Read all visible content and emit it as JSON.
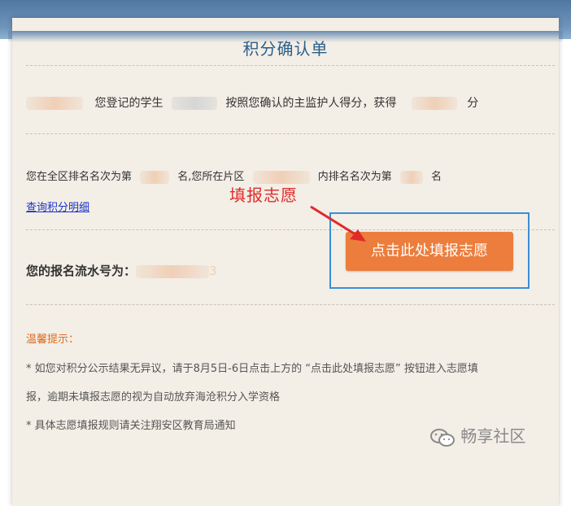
{
  "form": {
    "title": "积分确认单",
    "line1_a": "您登记的学生",
    "line1_b": "按照您确认的主监护人得分，获得",
    "line1_c": "分",
    "line2_a": "您在全区排名名次为第",
    "line2_b": "名,您所在片区",
    "line2_c": "内排名名次为第",
    "line2_d": "名",
    "query_link": "查询积分明细",
    "serial_label": "您的报名流水号为：",
    "serial_tail": "3",
    "submit_button": "点击此处填报志愿",
    "tips_title": "温馨提示：",
    "tip1": "* 如您对积分公示结果无异议，请于8月5日-6日点击上方的 “点击此处填报志愿” 按钮进入志愿填",
    "tip2": "报，逾期未填报志愿的视为自动放弃海沧积分入学资格",
    "tip3": "* 具体志愿填报规则请关注翔安区教育局通知"
  },
  "annotation": {
    "label": "填报志愿",
    "color": "#e02a2a"
  },
  "watermark": {
    "text": "畅享社区",
    "icon": "wechat-icon"
  },
  "colors": {
    "title": "#2a5f8a",
    "button_bg": "#ec7d3c",
    "highlight_box": "#3a8fd6",
    "tips": "#e06a1a",
    "link": "#1a33c8"
  }
}
